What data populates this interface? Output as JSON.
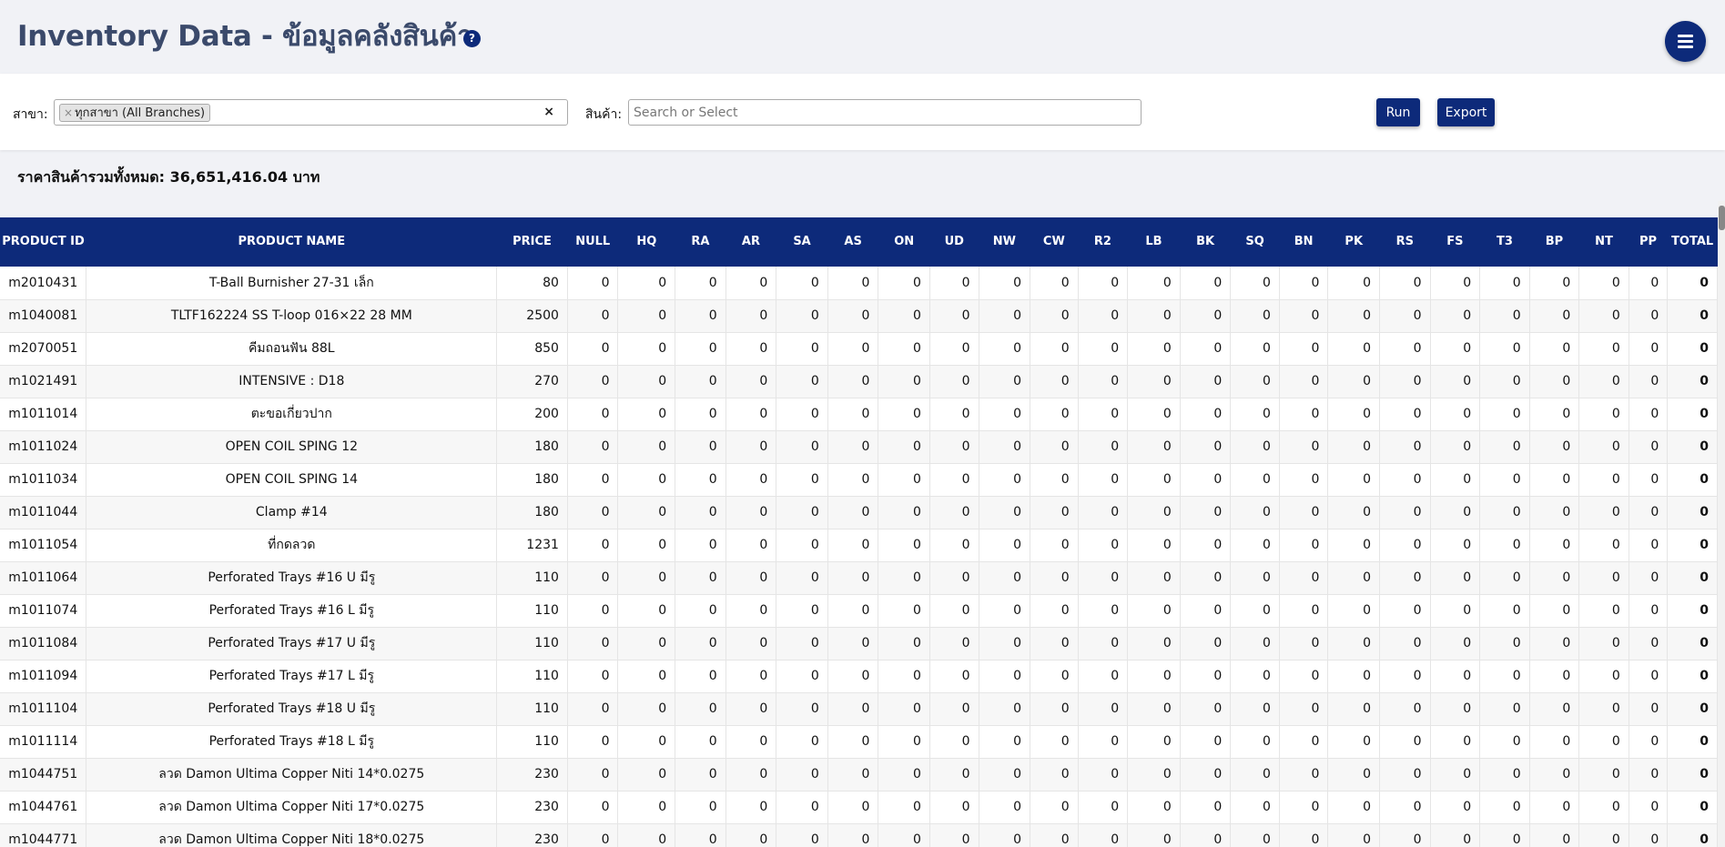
{
  "header": {
    "title": "Inventory Data - ข้อมูลคลังสินค้า",
    "help_icon": "?"
  },
  "filters": {
    "branch_label": "สาขา:",
    "branch_selected": "ทุกสาขา (All Branches)",
    "branch_tag_remove": "×",
    "branch_clear": "×",
    "product_label": "สินค้า:",
    "product_placeholder": "Search or Select",
    "run_label": "Run",
    "export_label": "Export"
  },
  "summary": {
    "total_value_text": "ราคาสินค้ารวมทั้งหมด: 36,651,416.04 บาท"
  },
  "table": {
    "columns": [
      "PRODUCT ID",
      "PRODUCT NAME",
      "PRICE",
      "NULL",
      "HQ",
      "RA",
      "AR",
      "SA",
      "AS",
      "ON",
      "UD",
      "NW",
      "CW",
      "R2",
      "LB",
      "BK",
      "SQ",
      "BN",
      "PK",
      "RS",
      "FS",
      "T3",
      "BP",
      "NT",
      "PP",
      "TOTAL"
    ],
    "rows": [
      {
        "id": "m2010431",
        "name": "T-Ball Burnisher 27-31 เล็ก",
        "price": "80",
        "total": "0"
      },
      {
        "id": "m1040081",
        "name": "TLTF162224 SS T-loop 016×22 28 MM",
        "price": "2500",
        "total": "0"
      },
      {
        "id": "m2070051",
        "name": "คีมถอนฟัน 88L",
        "price": "850",
        "total": "0"
      },
      {
        "id": "m1021491",
        "name": "INTENSIVE : D18",
        "price": "270",
        "total": "0"
      },
      {
        "id": "m1011014",
        "name": "ตะขอเกี่ยวปาก",
        "price": "200",
        "total": "0"
      },
      {
        "id": "m1011024",
        "name": "OPEN COIL SPING 12",
        "price": "180",
        "total": "0"
      },
      {
        "id": "m1011034",
        "name": "OPEN COIL SPING 14",
        "price": "180",
        "total": "0"
      },
      {
        "id": "m1011044",
        "name": "Clamp #14",
        "price": "180",
        "total": "0"
      },
      {
        "id": "m1011054",
        "name": "ที่กดลวด",
        "price": "1231",
        "total": "0"
      },
      {
        "id": "m1011064",
        "name": "Perforated Trays #16 U มีรู",
        "price": "110",
        "total": "0"
      },
      {
        "id": "m1011074",
        "name": "Perforated Trays #16 L มีรู",
        "price": "110",
        "total": "0"
      },
      {
        "id": "m1011084",
        "name": "Perforated Trays #17 U มีรู",
        "price": "110",
        "total": "0"
      },
      {
        "id": "m1011094",
        "name": "Perforated Trays #17 L มีรู",
        "price": "110",
        "total": "0"
      },
      {
        "id": "m1011104",
        "name": "Perforated Trays #18 U มีรู",
        "price": "110",
        "total": "0"
      },
      {
        "id": "m1011114",
        "name": "Perforated Trays #18 L มีรู",
        "price": "110",
        "total": "0"
      },
      {
        "id": "m1044751",
        "name": "ลวด Damon Ultima Copper Niti 14*0.0275",
        "price": "230",
        "total": "0"
      },
      {
        "id": "m1044761",
        "name": "ลวด Damon Ultima Copper Niti 17*0.0275",
        "price": "230",
        "total": "0"
      },
      {
        "id": "m1044771",
        "name": "ลวด Damon Ultima Copper Niti 18*0.0275",
        "price": "230",
        "total": "0"
      }
    ],
    "branch_qty": "0"
  },
  "colors": {
    "primary": "#0d2a7a",
    "title": "#3b4a6b",
    "background": "#f1f2f6"
  },
  "icons": {
    "help": "help-icon",
    "menu": "hamburger-menu-icon",
    "remove": "close-icon"
  }
}
